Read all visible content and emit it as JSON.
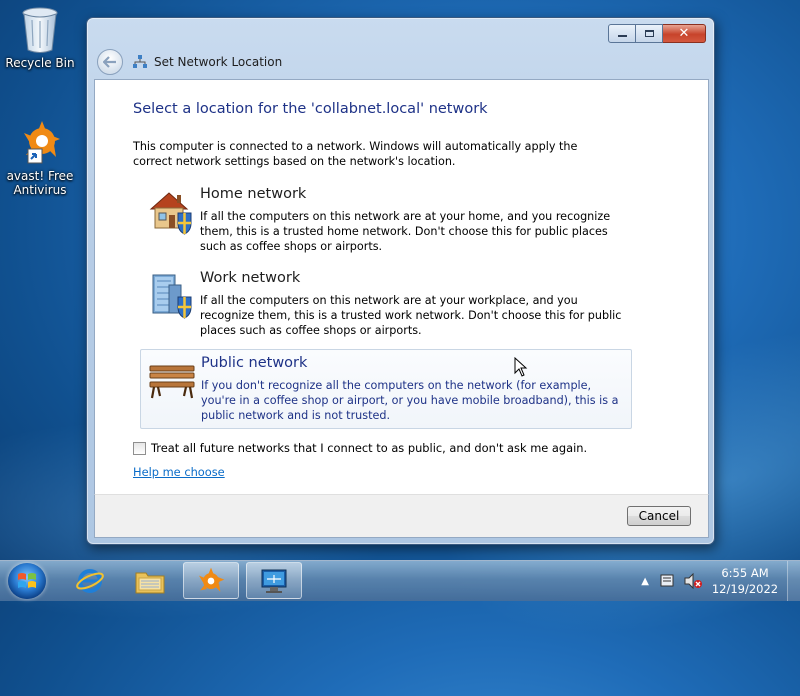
{
  "desktop": {
    "icons": [
      {
        "label": "Recycle Bin"
      },
      {
        "label": "avast! Free Antivirus"
      }
    ]
  },
  "window": {
    "title": "Set Network Location",
    "heading": "Select a location for the 'collabnet.local' network",
    "intro": "This computer is connected to a network. Windows will automatically apply the correct network settings based on the network's location.",
    "options": [
      {
        "title": "Home network",
        "description": "If all the computers on this network are at your home, and you recognize them, this is a trusted home network.  Don't choose this for public places such as coffee shops or airports."
      },
      {
        "title": "Work network",
        "description": "If all the computers on this network are at your workplace, and you recognize them, this is a trusted work network.  Don't choose this for public places such as coffee shops or airports."
      },
      {
        "title": "Public network",
        "description": "If you don't recognize all the computers on the network (for example, you're in a coffee shop or airport, or you have mobile broadband), this is a public network and is not trusted."
      }
    ],
    "checkbox_label": "Treat all future networks that I connect to as public, and don't ask me again.",
    "checkbox_checked": false,
    "help_link": "Help me choose",
    "cancel_label": "Cancel"
  },
  "taskbar": {
    "pinned": [
      "Internet Explorer",
      "Windows Explorer",
      "avast! Free Antivirus",
      "Network and Sharing Center"
    ],
    "clock": {
      "time": "6:55 AM",
      "date": "12/19/2022"
    }
  }
}
